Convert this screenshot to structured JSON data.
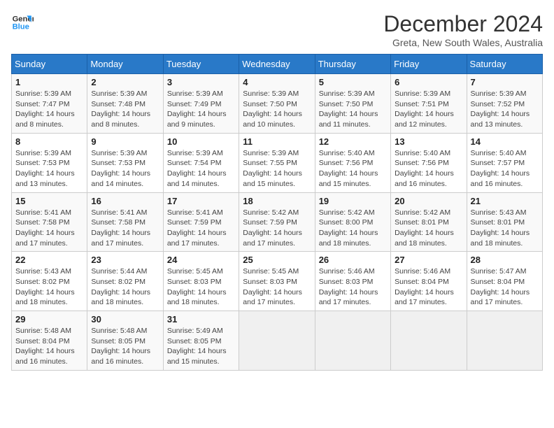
{
  "logo": {
    "line1": "General",
    "line2": "Blue"
  },
  "title": "December 2024",
  "subtitle": "Greta, New South Wales, Australia",
  "days_of_week": [
    "Sunday",
    "Monday",
    "Tuesday",
    "Wednesday",
    "Thursday",
    "Friday",
    "Saturday"
  ],
  "weeks": [
    [
      {
        "day": "1",
        "sunrise": "5:39 AM",
        "sunset": "7:47 PM",
        "daylight": "14 hours and 8 minutes."
      },
      {
        "day": "2",
        "sunrise": "5:39 AM",
        "sunset": "7:48 PM",
        "daylight": "14 hours and 8 minutes."
      },
      {
        "day": "3",
        "sunrise": "5:39 AM",
        "sunset": "7:49 PM",
        "daylight": "14 hours and 9 minutes."
      },
      {
        "day": "4",
        "sunrise": "5:39 AM",
        "sunset": "7:50 PM",
        "daylight": "14 hours and 10 minutes."
      },
      {
        "day": "5",
        "sunrise": "5:39 AM",
        "sunset": "7:50 PM",
        "daylight": "14 hours and 11 minutes."
      },
      {
        "day": "6",
        "sunrise": "5:39 AM",
        "sunset": "7:51 PM",
        "daylight": "14 hours and 12 minutes."
      },
      {
        "day": "7",
        "sunrise": "5:39 AM",
        "sunset": "7:52 PM",
        "daylight": "14 hours and 13 minutes."
      }
    ],
    [
      {
        "day": "8",
        "sunrise": "5:39 AM",
        "sunset": "7:53 PM",
        "daylight": "14 hours and 13 minutes."
      },
      {
        "day": "9",
        "sunrise": "5:39 AM",
        "sunset": "7:53 PM",
        "daylight": "14 hours and 14 minutes."
      },
      {
        "day": "10",
        "sunrise": "5:39 AM",
        "sunset": "7:54 PM",
        "daylight": "14 hours and 14 minutes."
      },
      {
        "day": "11",
        "sunrise": "5:39 AM",
        "sunset": "7:55 PM",
        "daylight": "14 hours and 15 minutes."
      },
      {
        "day": "12",
        "sunrise": "5:40 AM",
        "sunset": "7:56 PM",
        "daylight": "14 hours and 15 minutes."
      },
      {
        "day": "13",
        "sunrise": "5:40 AM",
        "sunset": "7:56 PM",
        "daylight": "14 hours and 16 minutes."
      },
      {
        "day": "14",
        "sunrise": "5:40 AM",
        "sunset": "7:57 PM",
        "daylight": "14 hours and 16 minutes."
      }
    ],
    [
      {
        "day": "15",
        "sunrise": "5:41 AM",
        "sunset": "7:58 PM",
        "daylight": "14 hours and 17 minutes."
      },
      {
        "day": "16",
        "sunrise": "5:41 AM",
        "sunset": "7:58 PM",
        "daylight": "14 hours and 17 minutes."
      },
      {
        "day": "17",
        "sunrise": "5:41 AM",
        "sunset": "7:59 PM",
        "daylight": "14 hours and 17 minutes."
      },
      {
        "day": "18",
        "sunrise": "5:42 AM",
        "sunset": "7:59 PM",
        "daylight": "14 hours and 17 minutes."
      },
      {
        "day": "19",
        "sunrise": "5:42 AM",
        "sunset": "8:00 PM",
        "daylight": "14 hours and 18 minutes."
      },
      {
        "day": "20",
        "sunrise": "5:42 AM",
        "sunset": "8:01 PM",
        "daylight": "14 hours and 18 minutes."
      },
      {
        "day": "21",
        "sunrise": "5:43 AM",
        "sunset": "8:01 PM",
        "daylight": "14 hours and 18 minutes."
      }
    ],
    [
      {
        "day": "22",
        "sunrise": "5:43 AM",
        "sunset": "8:02 PM",
        "daylight": "14 hours and 18 minutes."
      },
      {
        "day": "23",
        "sunrise": "5:44 AM",
        "sunset": "8:02 PM",
        "daylight": "14 hours and 18 minutes."
      },
      {
        "day": "24",
        "sunrise": "5:45 AM",
        "sunset": "8:03 PM",
        "daylight": "14 hours and 18 minutes."
      },
      {
        "day": "25",
        "sunrise": "5:45 AM",
        "sunset": "8:03 PM",
        "daylight": "14 hours and 17 minutes."
      },
      {
        "day": "26",
        "sunrise": "5:46 AM",
        "sunset": "8:03 PM",
        "daylight": "14 hours and 17 minutes."
      },
      {
        "day": "27",
        "sunrise": "5:46 AM",
        "sunset": "8:04 PM",
        "daylight": "14 hours and 17 minutes."
      },
      {
        "day": "28",
        "sunrise": "5:47 AM",
        "sunset": "8:04 PM",
        "daylight": "14 hours and 17 minutes."
      }
    ],
    [
      {
        "day": "29",
        "sunrise": "5:48 AM",
        "sunset": "8:04 PM",
        "daylight": "14 hours and 16 minutes."
      },
      {
        "day": "30",
        "sunrise": "5:48 AM",
        "sunset": "8:05 PM",
        "daylight": "14 hours and 16 minutes."
      },
      {
        "day": "31",
        "sunrise": "5:49 AM",
        "sunset": "8:05 PM",
        "daylight": "14 hours and 15 minutes."
      },
      null,
      null,
      null,
      null
    ]
  ]
}
